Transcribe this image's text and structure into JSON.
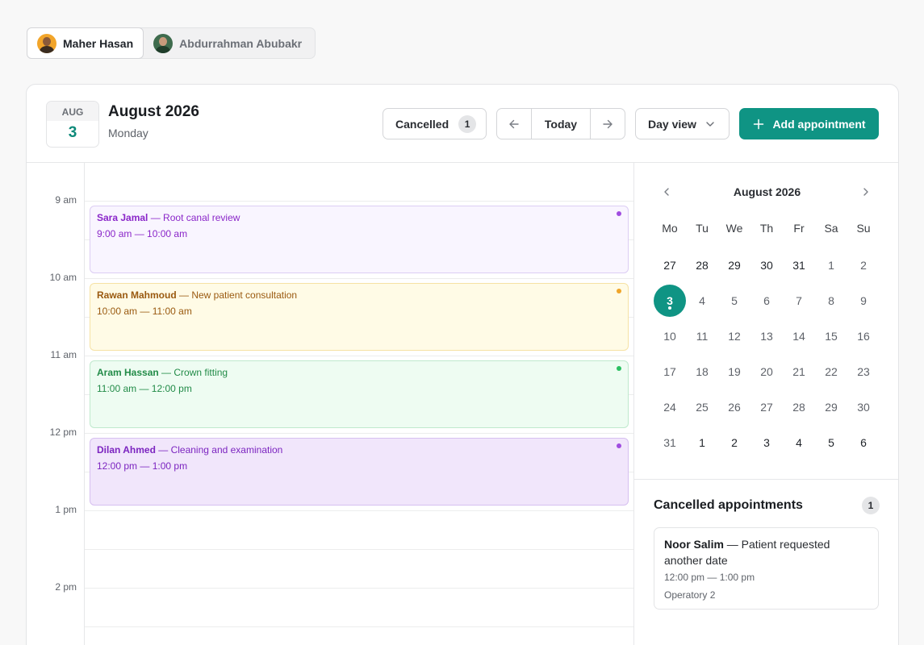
{
  "providers": [
    {
      "name": "Maher Hasan",
      "active": true
    },
    {
      "name": "Abdurrahman Abubakr",
      "active": false
    }
  ],
  "header": {
    "month_abbr": "AUG",
    "day_number": "3",
    "title": "August 2026",
    "weekday": "Monday",
    "cancelled_label": "Cancelled",
    "cancelled_count": "1",
    "today_label": "Today",
    "view_label": "Day view",
    "add_label": "Add appointment"
  },
  "timeline": {
    "hours": [
      "9 am",
      "10 am",
      "11 am",
      "12 pm",
      "1 pm",
      "2 pm"
    ],
    "events": [
      {
        "patient": "Sara Jamal",
        "reason": " — Root canal review",
        "time": "9:00 am — 10:00 am",
        "bg": "#f9f5ff",
        "border": "#dccdf3",
        "text": "#8a26c9",
        "dot": "#a04de0"
      },
      {
        "patient": "Rawan Mahmoud",
        "reason": " — New patient consultation",
        "time": "10:00 am — 11:00 am",
        "bg": "#fffbe6",
        "border": "#f6e2a4",
        "text": "#9a5a10",
        "dot": "#f0a52a"
      },
      {
        "patient": "Aram Hassan",
        "reason": " — Crown fitting",
        "time": "11:00 am — 12:00 pm",
        "bg": "#eefcf2",
        "border": "#bfe9cd",
        "text": "#228b48",
        "dot": "#2cc062"
      },
      {
        "patient": "Dilan Ahmed",
        "reason": " — Cleaning and examination",
        "time": "12:00 pm — 1:00 pm",
        "bg": "#f1e6fb",
        "border": "#d6bff0",
        "text": "#7c25c0",
        "dot": "#a04de0"
      }
    ]
  },
  "mini_calendar": {
    "title": "August 2026",
    "weekdays": [
      "Mo",
      "Tu",
      "We",
      "Th",
      "Fr",
      "Sa",
      "Su"
    ],
    "weeks": [
      [
        "27",
        "28",
        "29",
        "30",
        "31",
        "1",
        "2"
      ],
      [
        "3",
        "4",
        "5",
        "6",
        "7",
        "8",
        "9"
      ],
      [
        "10",
        "11",
        "12",
        "13",
        "14",
        "15",
        "16"
      ],
      [
        "17",
        "18",
        "19",
        "20",
        "21",
        "22",
        "23"
      ],
      [
        "24",
        "25",
        "26",
        "27",
        "28",
        "29",
        "30"
      ],
      [
        "31",
        "1",
        "2",
        "3",
        "4",
        "5",
        "6"
      ]
    ],
    "selected": "3",
    "accent": "#0f9484"
  },
  "cancelled_panel": {
    "title": "Cancelled appointments",
    "count": "1",
    "items": [
      {
        "patient": "Noor Salim",
        "reason": " — Patient requested another date",
        "time": "12:00 pm — 1:00 pm",
        "room": "Operatory 2"
      }
    ]
  }
}
